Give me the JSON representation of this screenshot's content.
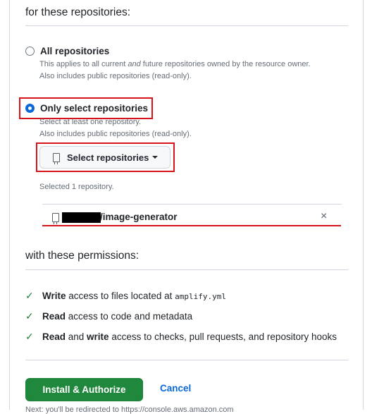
{
  "repositories": {
    "heading": "for these repositories:",
    "options": [
      {
        "label": "All repositories",
        "hint_lines": [
          "This applies to all current and future repositories owned by the resource owner.",
          "Also includes public repositories (read-only)."
        ],
        "checked": false
      },
      {
        "label": "Only select repositories",
        "hint_lines": [
          "Select at least one repository.",
          "Also includes public repositories (read-only)."
        ],
        "checked": true
      }
    ],
    "select_button_label": "Select repositories",
    "selected_count_text": "Selected 1 repository.",
    "selected_repo": {
      "name_visible": "/image-generator",
      "remove_glyph": "×"
    }
  },
  "permissions": {
    "heading": "with these permissions:",
    "items": [
      {
        "bold1": "Write",
        "text1": " access to files located at ",
        "code": "amplify.yml",
        "bold2": "",
        "text2": ""
      },
      {
        "bold1": "Read",
        "text1": " access to code and metadata",
        "code": "",
        "bold2": "",
        "text2": ""
      },
      {
        "bold1": "Read",
        "text1": " and ",
        "code": "",
        "bold2": "write",
        "text2": " access to checks, pull requests, and repository hooks"
      }
    ]
  },
  "actions": {
    "install_label": "Install & Authorize",
    "cancel_label": "Cancel",
    "footnote": "Next: you'll be redirected to https://console.aws.amazon.com"
  },
  "colors": {
    "primary_green": "#1f883d",
    "link_blue": "#0969da",
    "highlight_red": "#d7141b",
    "check_green": "#1a7f37"
  },
  "icons": [
    "repo-icon",
    "caret-down-icon",
    "close-icon",
    "check-icon"
  ]
}
